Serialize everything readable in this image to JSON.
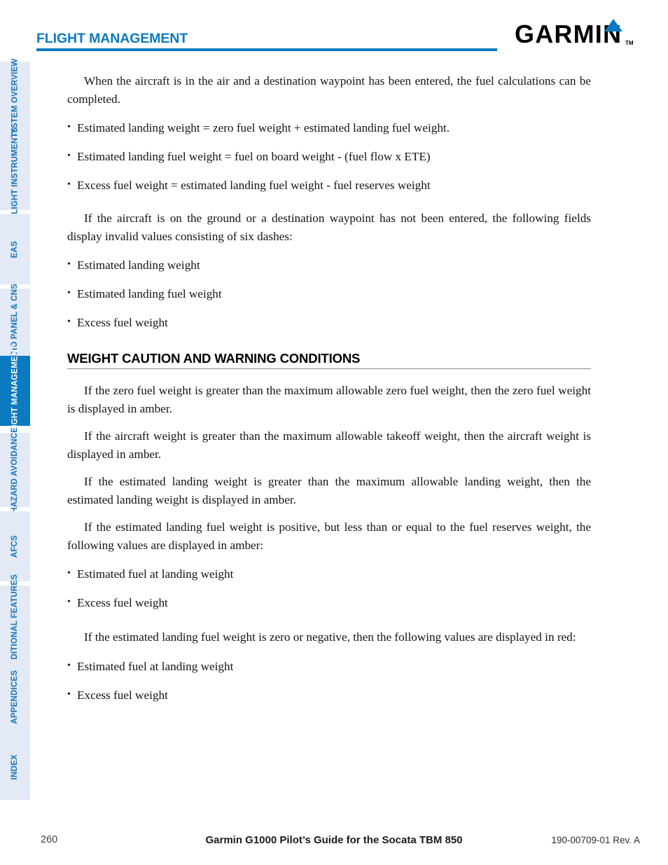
{
  "header": {
    "chapter_title": "FLIGHT MANAGEMENT",
    "rule_color": "#0b7ac0"
  },
  "logo": {
    "wordmark": "GARMIN",
    "trademark": "TM",
    "triangle_color": "#0b7ac0"
  },
  "sidebar": {
    "active_color": "#0b7ac0",
    "inactive_bg": "#e3e9f5",
    "inactive_text": "#1275bc",
    "items": [
      {
        "label": "SYSTEM OVERVIEW",
        "active": false
      },
      {
        "label": "FLIGHT INSTRUMENTS",
        "active": false
      },
      {
        "label": "EAS",
        "active": false
      },
      {
        "label": "AUDIO PANEL & CNS",
        "active": false
      },
      {
        "label": "FLIGHT MANAGEMENT",
        "active": true
      },
      {
        "label": "HAZARD AVOIDANCE",
        "active": false
      },
      {
        "label": "AFCS",
        "active": false
      },
      {
        "label": "ADDITIONAL FEATURES",
        "active": false
      },
      {
        "label": "APPENDICES",
        "active": false
      },
      {
        "label": "INDEX",
        "active": false
      }
    ]
  },
  "content": {
    "para_1": "When the aircraft is in the air and a destination waypoint has been entered, the fuel calculations can be completed.",
    "bullets_1": [
      "Estimated landing weight =  zero fuel weight +  estimated landing fuel weight.",
      "Estimated landing fuel weight =  fuel on board weight - (fuel flow x ETE)",
      "Excess fuel weight =  estimated landing fuel weight - fuel reserves weight"
    ],
    "para_2": "If the aircraft is on the ground or a destination waypoint has not been entered, the following fields display invalid values consisting of six dashes:",
    "bullets_2": [
      "Estimated landing weight",
      "Estimated landing fuel weight",
      "Excess fuel weight"
    ],
    "section_heading": "WEIGHT CAUTION AND WARNING CONDITIONS",
    "para_3": "If the zero fuel weight is greater than the maximum allowable zero fuel weight, then the zero fuel weight is displayed in amber.",
    "para_4": "If the aircraft weight is greater than the maximum allowable takeoff weight, then the aircraft weight is displayed in amber.",
    "para_5": "If the estimated landing weight is greater than the maximum allowable landing weight, then the estimated landing weight is displayed in amber.",
    "para_6": "If the estimated landing fuel weight is positive, but less than or equal to the fuel reserves weight, the following values are displayed in amber:",
    "bullets_3": [
      "Estimated fuel at landing weight",
      "Excess fuel weight"
    ],
    "para_7": "If the estimated landing fuel weight is zero or negative, then the following values are displayed in red:",
    "bullets_4": [
      "Estimated fuel at landing weight",
      "Excess fuel weight"
    ]
  },
  "footer": {
    "page_number": "260",
    "title": "Garmin G1000 Pilot’s Guide for the Socata TBM 850",
    "doc_number": "190-00709-01  Rev. A"
  }
}
